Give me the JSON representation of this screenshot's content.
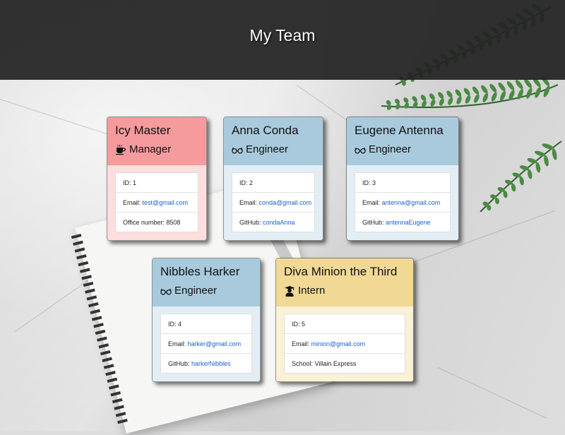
{
  "header": {
    "title": "My Team"
  },
  "colors": {
    "manager": "#f59b9d",
    "engineer": "#a8cadc",
    "intern": "#f2d895",
    "link": "#1a5fd0"
  },
  "cards": [
    {
      "name": "Icy Master",
      "role": "Manager",
      "icon": "coffee-icon",
      "id": "ID: 1",
      "email_label": "Email: ",
      "email": "test@gmail.com",
      "extra": "Office number: 8508"
    },
    {
      "name": "Anna Conda",
      "role": "Engineer",
      "icon": "glasses-icon",
      "id": "ID: 2",
      "email_label": "Email: ",
      "email": "conda@gmail.com",
      "extra_label": "GitHub: ",
      "extra_link": "condaAnna"
    },
    {
      "name": "Eugene Antenna",
      "role": "Engineer",
      "icon": "glasses-icon",
      "id": "ID: 3",
      "email_label": "Email: ",
      "email": "antenna@gmail.com",
      "extra_label": "GitHub: ",
      "extra_link": "antennaEugene"
    },
    {
      "name": "Nibbles Harker",
      "role": "Engineer",
      "icon": "glasses-icon",
      "id": "ID: 4",
      "email_label": "Email: ",
      "email": "harker@gmail.com",
      "extra_label": "GitHub: ",
      "extra_link": "harkerNibbles"
    },
    {
      "name": "Diva Minion the Third",
      "role": "Intern",
      "icon": "graduate-icon",
      "id": "ID: 5",
      "email_label": "Email: ",
      "email": "minion@gmail.com",
      "extra": "School: Villain Express"
    }
  ]
}
